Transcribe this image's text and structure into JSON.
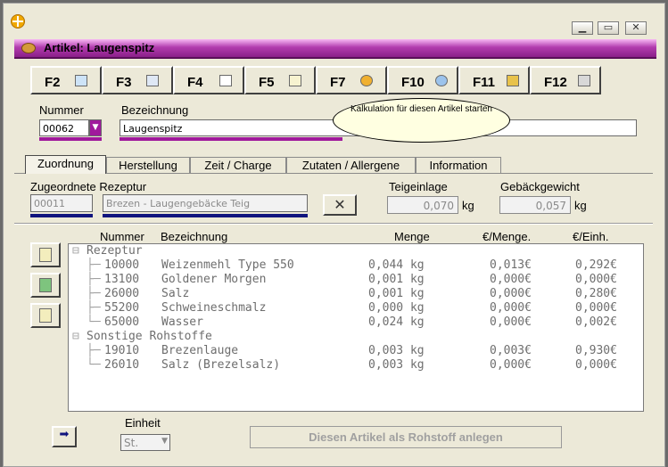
{
  "window": {
    "title": "Artikel: Laugenspitz",
    "controls": {
      "minimize": "▁",
      "restore": "▭",
      "close": "✕"
    }
  },
  "fkeys": [
    {
      "label": "F2",
      "icon": "recycle-icon"
    },
    {
      "label": "F3",
      "icon": "copy-icon"
    },
    {
      "label": "F4",
      "icon": "new-document-icon"
    },
    {
      "label": "F5",
      "icon": "edit-icon"
    },
    {
      "label": "F7",
      "icon": "euro-coin-icon"
    },
    {
      "label": "F10",
      "icon": "refresh-icon"
    },
    {
      "label": "F11",
      "icon": "key-icon"
    },
    {
      "label": "F12",
      "icon": "printer-icon"
    }
  ],
  "tooltip": "Kalkulation für diesen Artikel starten",
  "form": {
    "nummer_label": "Nummer",
    "nummer_value": "00062",
    "bezeichnung_label": "Bezeichnung",
    "bezeichnung_value": "Laugenspitz"
  },
  "tabs": [
    "Zuordnung",
    "Herstellung",
    "Zeit / Charge",
    "Zutaten / Allergene",
    "Information"
  ],
  "zuordnung": {
    "rezeptur_label": "Zugeordnete Rezeptur",
    "rezeptur_nr": "00011",
    "rezeptur_name": "Brezen - Laugengebäcke Teig",
    "clear_button": "✕",
    "teigeinlage_label": "Teigeinlage",
    "teigeinlage_value": "0,070",
    "teigeinlage_unit": "kg",
    "gebaeck_label": "Gebäckgewicht",
    "gebaeck_value": "0,057",
    "gebaeck_unit": "kg"
  },
  "table": {
    "headers": {
      "nummer": "Nummer",
      "bezeichnung": "Bezeichnung",
      "menge": "Menge",
      "eur_menge": "€/Menge.",
      "eur_einh": "€/Einh."
    },
    "groups": [
      {
        "label": "Rezeptur",
        "rows": [
          {
            "nr": "10000",
            "name": "Weizenmehl Type 550",
            "menge": "0,044 kg",
            "eur_menge": "0,013€",
            "eur_einh": "0,292€"
          },
          {
            "nr": "13100",
            "name": "Goldener Morgen",
            "menge": "0,001 kg",
            "eur_menge": "0,000€",
            "eur_einh": "0,000€"
          },
          {
            "nr": "26000",
            "name": "Salz",
            "menge": "0,001 kg",
            "eur_menge": "0,000€",
            "eur_einh": "0,280€"
          },
          {
            "nr": "55200",
            "name": "Schweineschmalz",
            "menge": "0,000 kg",
            "eur_menge": "0,000€",
            "eur_einh": "0,000€"
          },
          {
            "nr": "65000",
            "name": "Wasser",
            "menge": "0,024 kg",
            "eur_menge": "0,000€",
            "eur_einh": "0,002€"
          }
        ]
      },
      {
        "label": "Sonstige Rohstoffe",
        "rows": [
          {
            "nr": "19010",
            "name": "Brezenlauge",
            "menge": "0,003 kg",
            "eur_menge": "0,003€",
            "eur_einh": "0,930€"
          },
          {
            "nr": "26010",
            "name": "Salz (Brezelsalz)",
            "menge": "0,003 kg",
            "eur_menge": "0,000€",
            "eur_einh": "0,000€"
          }
        ]
      }
    ]
  },
  "bottom": {
    "einheit_label": "Einheit",
    "einheit_value": "St.",
    "action_button": "Diesen Artikel als Rohstoff anlegen"
  }
}
